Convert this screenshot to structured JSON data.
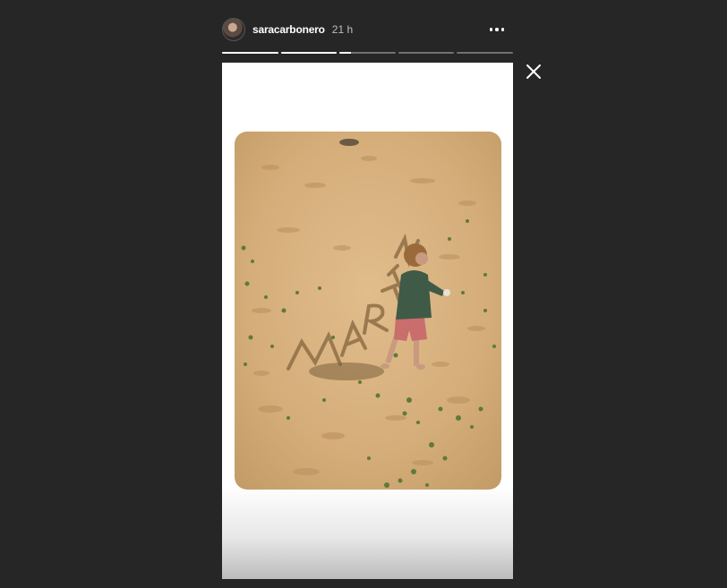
{
  "header": {
    "username": "saracarbonero",
    "time": "21 h"
  },
  "progress": {
    "segments": 5,
    "current_index": 2,
    "current_fraction": 0.2
  },
  "icons": {
    "more": "more-options-icon",
    "close": "close-icon",
    "avatar": "avatar"
  },
  "photo": {
    "sand_text": "MARTIN"
  },
  "colors": {
    "background": "#262626",
    "sand": "#d9b27e",
    "shirt": "#3f5a47",
    "shorts": "#c96d6d"
  }
}
